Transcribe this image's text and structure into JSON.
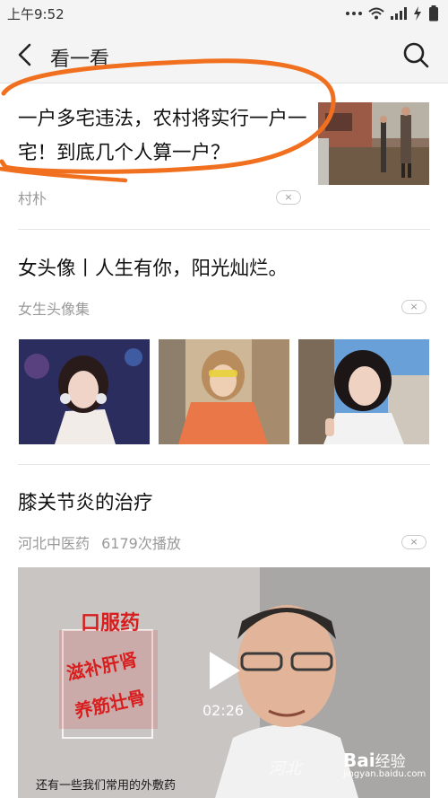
{
  "status_bar": {
    "time": "上午9:52"
  },
  "header": {
    "title": "看一看"
  },
  "articles": [
    {
      "title": "一户多宅违法，农村将实行一户一宅！到底几个人算一户？",
      "source": "村朴"
    },
    {
      "title": "女头像丨人生有你，阳光灿烂。",
      "source": "女生头像集"
    },
    {
      "title": "膝关节炎的治疗",
      "source": "河北中医药",
      "plays": "6179次播放",
      "video": {
        "duration": "02:26",
        "overlay_title": "口服药",
        "overlay_line1": "滋补肝肾",
        "overlay_line2": "养筋壮骨",
        "subtitle": "还有一些我们常用的外敷药",
        "watermark": "河北"
      }
    }
  ],
  "close_label": "×",
  "baidu_watermark": {
    "logo": "Bai",
    "text": "经验",
    "url": "jingyan.baidu.com"
  },
  "colors": {
    "annotation": "#f07020",
    "accent_red": "#d81e1e"
  }
}
